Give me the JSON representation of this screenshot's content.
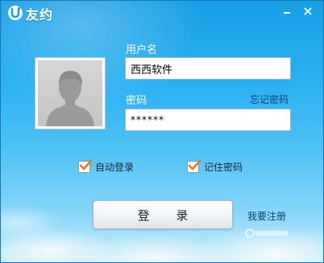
{
  "window": {
    "title": "友约",
    "background_top": "#1a9ee6",
    "background_bottom": "#c9ecfb"
  },
  "titlebar": {
    "logo_icon": "app-logo-icon",
    "minimize_icon": "minimize-icon",
    "close_icon": "close-icon"
  },
  "avatar": {
    "icon": "user-silhouette-icon"
  },
  "form": {
    "username_label": "用户名",
    "username_value": "西西软件",
    "password_label": "密码",
    "password_value": "******",
    "forgot_password_link": "忘记密码",
    "auto_login_label": "自动登录",
    "auto_login_checked": true,
    "remember_password_label": "记住密码",
    "remember_password_checked": true,
    "login_button_label": "登 录",
    "register_link": "我要注册"
  },
  "colors": {
    "check_mark": "#e77b12",
    "link": "#0b3f7a"
  }
}
